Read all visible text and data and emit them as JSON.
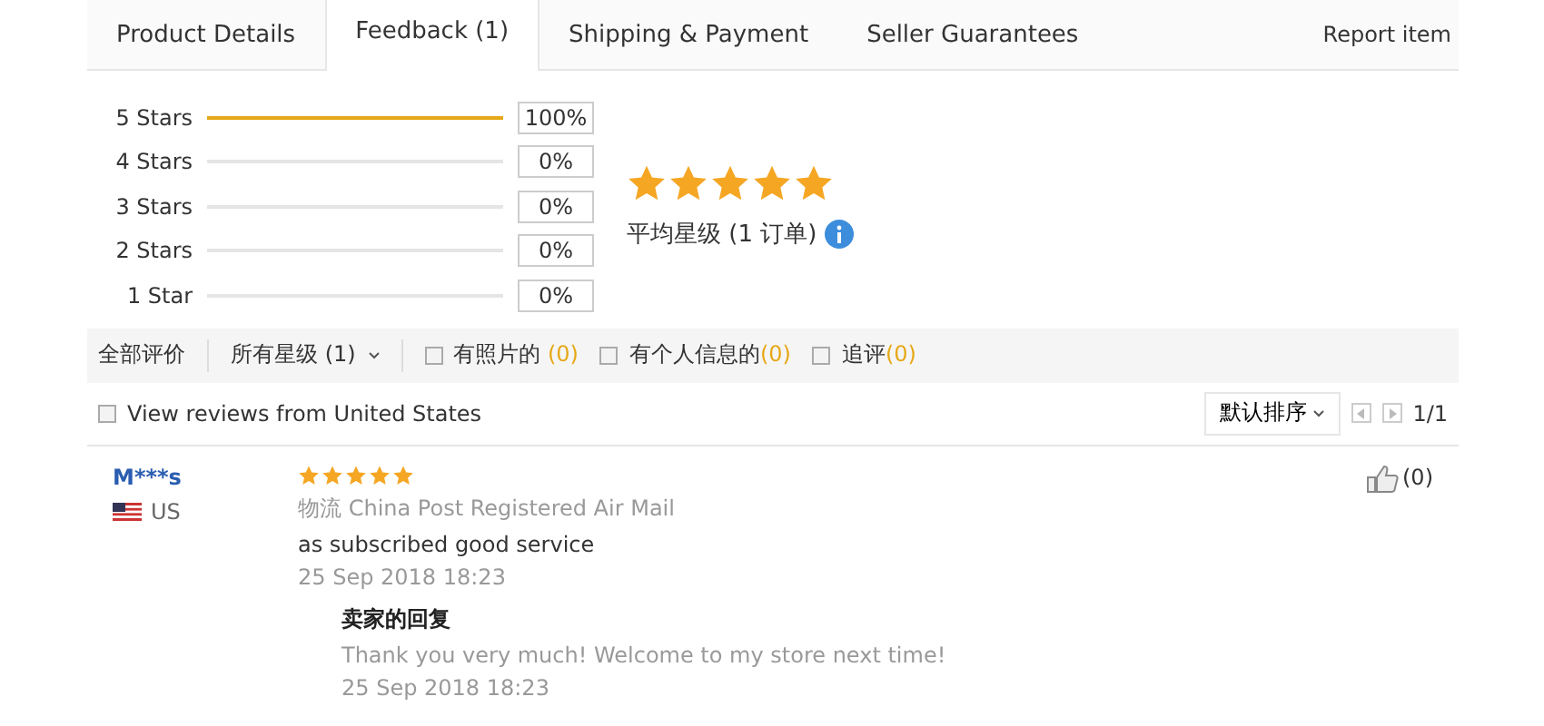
{
  "tabs": [
    {
      "label": "Product Details",
      "selected": false
    },
    {
      "label": "Feedback (1)",
      "selected": true
    },
    {
      "label": "Shipping & Payment",
      "selected": false
    },
    {
      "label": "Seller Guarantees",
      "selected": false
    }
  ],
  "report_link": "Report item",
  "rating_bars": [
    {
      "label": "5 Stars",
      "level": 1,
      "percent": "100%"
    },
    {
      "label": "4 Stars",
      "percent": "0%"
    },
    {
      "label": "3 Stars",
      "percent": "0%"
    },
    {
      "label": "2 Stars",
      "percent": "0%"
    },
    {
      "label": "1 Star",
      "percent": "0%"
    }
  ],
  "summary": {
    "stars": 5,
    "caption": "平均星级 (1 订单)"
  },
  "filter_bar": {
    "all_label": "全部评价",
    "star_dropdown": "所有星级 (1)",
    "filters": [
      {
        "label": "有照片的 ",
        "count": "(0)",
        "checked": false
      },
      {
        "label": "有个人信息的",
        "count": "(0)",
        "checked": false
      },
      {
        "label": "追评",
        "count": "(0)",
        "checked": false
      }
    ]
  },
  "country_filter": {
    "label": "View reviews from United States",
    "checked": false
  },
  "sort_dropdown": "默认排序",
  "pager": "1/1",
  "reviews": [
    {
      "user": "M***s",
      "country": "US",
      "stars": 5,
      "shipping_label": "物流",
      "shipping": "China Post Registered Air Mail",
      "text": "as subscribed good service",
      "date": "25 Sep 2018 18:23",
      "likes": "(0)",
      "reply": {
        "title": "卖家的回复",
        "text": "Thank you very much! Welcome to my store next time!",
        "date": "25 Sep 2018 18:23"
      }
    }
  ]
}
